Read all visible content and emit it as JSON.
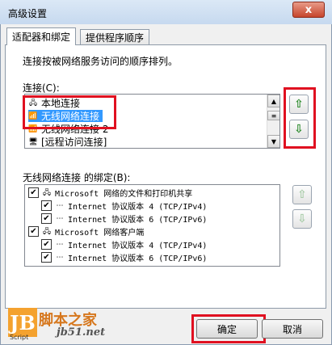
{
  "window": {
    "title": "高级设置",
    "close_label": "x"
  },
  "tabs": [
    {
      "label": "适配器和绑定"
    },
    {
      "label": "提供程序顺序"
    }
  ],
  "description": "连接按被网络服务访问的顺序排列。",
  "connections": {
    "label": "连接(C):",
    "items": [
      "本地连接",
      "无线网络连接",
      "无线网络连接 2",
      "[远程访问连接]"
    ],
    "selected_index": 1
  },
  "bindings": {
    "label": "无线网络连接 的绑定(B):",
    "items": [
      {
        "text": "Microsoft 网络的文件和打印机共享",
        "checked": true,
        "level": 0,
        "icon": "network-share-icon"
      },
      {
        "text": "Internet 协议版本 4 (TCP/IPv4)",
        "checked": true,
        "level": 1,
        "icon": "protocol-icon"
      },
      {
        "text": "Internet 协议版本 6 (TCP/IPv6)",
        "checked": true,
        "level": 1,
        "icon": "protocol-icon"
      },
      {
        "text": "Microsoft 网络客户端",
        "checked": true,
        "level": 0,
        "icon": "network-client-icon"
      },
      {
        "text": "Internet 协议版本 4 (TCP/IPv4)",
        "checked": true,
        "level": 1,
        "icon": "protocol-icon"
      },
      {
        "text": "Internet 协议版本 6 (TCP/IPv6)",
        "checked": true,
        "level": 1,
        "icon": "protocol-icon"
      }
    ]
  },
  "buttons": {
    "ok": "确定",
    "cancel": "取消"
  },
  "watermark": {
    "brand": "脚本之家",
    "url": "jb51.net",
    "logo": "JB",
    "script": "Script"
  },
  "colors": {
    "selection": "#3399ff",
    "highlight": "#e01020",
    "move_up": "#2a8a2a"
  }
}
